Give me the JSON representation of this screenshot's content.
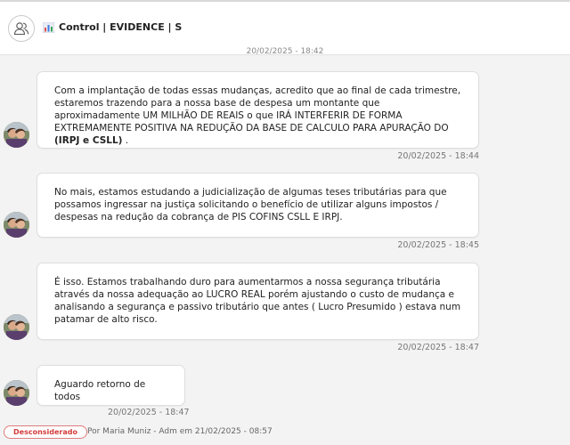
{
  "header": {
    "title": "Control | EVIDENCE | S",
    "group_icon": "users-icon",
    "title_icon": "bar-chart-emoji-icon"
  },
  "top_date_fragment": "20/02/2025 - 18:42",
  "messages": [
    {
      "text_plain": "Com a implantação de todas essas mudanças, acredito que ao final de cada trimestre, estaremos trazendo para a nossa base de despesa um montante que aproximadamente UM MILHÃO DE REAIS o que IRÁ INTERFERIR DE FORMA EXTREMAMENTE POSITIVA NA REDUÇÃO DA BASE DE CALCULO PARA APURAÇÃO DO ",
      "text_bold": "(IRPJ e CSLL)",
      "text_end": " .",
      "timestamp": "20/02/2025 - 18:44"
    },
    {
      "text_plain": "No mais, estamos estudando a judicialização de algumas teses tributárias para que possamos ingressar na justiça solicitando o benefício de utilizar alguns impostos / despesas na redução da cobrança de PIS COFINS CSLL E IRPJ.",
      "timestamp": "20/02/2025 - 18:45"
    },
    {
      "text_plain": "É isso. Estamos trabalhando duro para aumentarmos a nossa segurança tributária através da nossa adequação ao LUCRO REAL porém ajustando o custo de mudança e analisando a segurança e passivo tributário que antes ( Lucro Presumido ) estava num patamar de alto risco.",
      "timestamp": "20/02/2025 - 18:47"
    },
    {
      "text_plain": "Aguardo retorno de todos",
      "timestamp": "20/02/2025 - 18:47"
    }
  ],
  "status": {
    "badge": "Desconsiderado",
    "by_line": "Por Maria Muniz - Adm em 21/02/2025 - 08:57",
    "badge_color": "#d43b3b"
  },
  "colors": {
    "background": "#f3f3f3",
    "bubble": "#ffffff"
  }
}
